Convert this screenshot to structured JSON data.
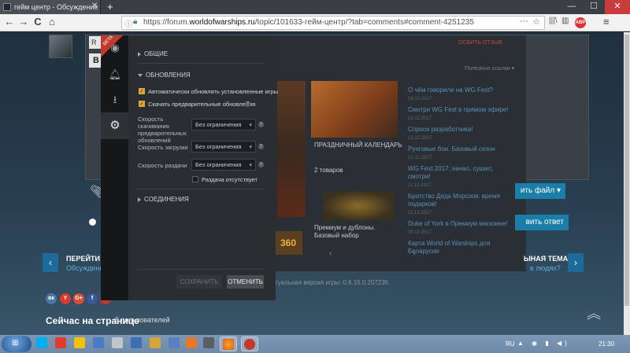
{
  "browser": {
    "tab_title": "гейм центр - Обсуждение",
    "tab_close": "✕",
    "new_tab": "+",
    "url_prefix": "https://forum.",
    "url_domain": "worldofwarships.ru",
    "url_path": "/topic/101633-гейм-центр/?tab=comments#comment-4251235",
    "more": "···",
    "star": "☆",
    "back": "←",
    "forward": "→",
    "reload": "C",
    "home": "⌂",
    "library": "|||\\",
    "sidebar": "▥",
    "abp": "ABP",
    "menu": "≡",
    "min": "—",
    "max": "☐",
    "close": "✕"
  },
  "forum": {
    "input_prefix": "R",
    "bold_btn": "B",
    "pick_file": "ить файл ▾",
    "send_reply": "вить ответ",
    "goto_label": "ПЕРЕЙТИ К С",
    "discussion_link": "Обсуждение",
    "next_topic": "ЫНАЯ ТЕМА",
    "people_link": "в людях?",
    "online_label": "Сейчас на странице",
    "online_count": "5 пользователей",
    "prev": "‹",
    "next": "›",
    "scroll_up": "︽",
    "social": [
      "вк",
      "Y",
      "G+",
      "f",
      "Я"
    ]
  },
  "background": {
    "show_button": "ОСВИТЬ ОТЗЫВ",
    "hidden_dropdown": "Полезные ссылки ▾",
    "calendar_label": "ПРАЗДНИЧНЫЙ КАЛЕНДАРЬ",
    "goods_label": "2 товаров",
    "goods_text": "Премиум и дублоны. Базовый набор",
    "big_360": "360",
    "arrows": "‹ ›",
    "news": [
      {
        "title": "О чём говорили на WG Fest?",
        "time": "18.12.2017"
      },
      {
        "title": "Смотри WG Fest в прямом эфире!",
        "time": "15.12.2017"
      },
      {
        "title": "Спроси разработчика!",
        "time": "13.12.2017"
      },
      {
        "title": "Рунговые бои. Базовый сезон",
        "time": "12.12.2017"
      },
      {
        "title": "WG Fest 2017: начал, сушил, смотри!",
        "time": "11.12.2017"
      },
      {
        "title": "Братство Деда Морозов: время подарков!",
        "time": "11.12.2017"
      },
      {
        "title": "Duke of York в Премиум магазине!",
        "time": "08.12.2017"
      },
      {
        "title": "Карта World of Warships для Беларусии",
        "time": ""
      }
    ],
    "version_text": "Актуальная версия игры: 0.6.15.0.207235"
  },
  "gamecenter": {
    "beta": "BETA",
    "sections": {
      "general": "ОБЩИЕ",
      "updates": "ОБНОВЛЕНИЯ",
      "connections": "СОЕДИНЕНИЯ"
    },
    "auto_update": "Автоматически обновлять установленные игры",
    "preload_updates": "Скачать предварительные обновления",
    "preload_speed_label": "Скорость скачивания предварительных обновлений",
    "download_speed_label": "Скорость загрузки",
    "upload_speed_label": "Скорость раздачи",
    "no_limit": "Без ограничения",
    "no_upload": "Раздача отсутствует",
    "save": "СОХРАНИТЬ",
    "cancel": "ОТМЕНИТЬ",
    "check": "✓",
    "help": "?",
    "caret": "▾"
  },
  "taskbar": {
    "lang": "RU",
    "clock": "21:30",
    "tray": "▲ ◉ ▮ ◀)"
  },
  "colors": {
    "accent_blue": "#1b7ea8",
    "checkbox_orange": "#e3a23b",
    "beta_red": "#c0392b",
    "link_blue": "#5aafe0"
  }
}
